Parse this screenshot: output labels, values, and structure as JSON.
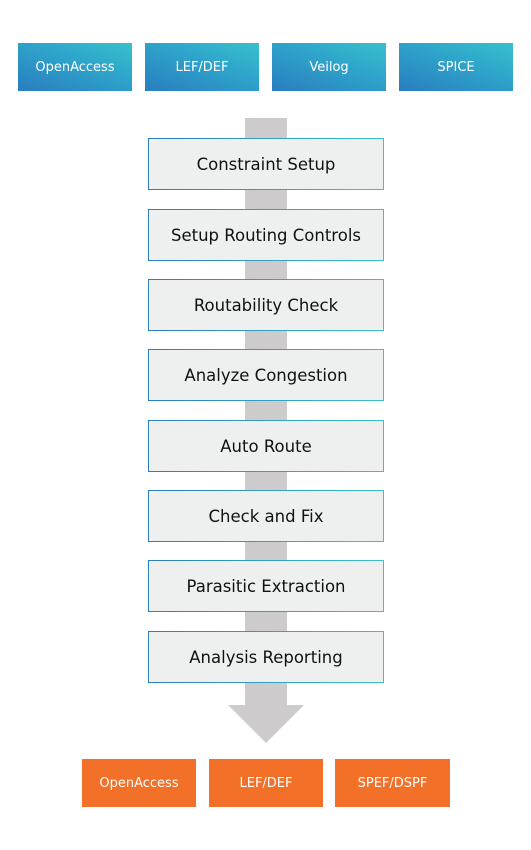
{
  "inputs": [
    "OpenAccess",
    "LEF/DEF",
    "Veilog",
    "SPICE"
  ],
  "steps": [
    "Constraint Setup",
    "Setup Routing Controls",
    "Routability Check",
    "Analyze Congestion",
    "Auto Route",
    "Check and Fix",
    "Parasitic Extraction",
    "Analysis Reporting"
  ],
  "outputs": [
    "OpenAccess",
    "LEF/DEF",
    "SPEF/DSPF"
  ],
  "colors": {
    "input_blue": "#2a7dbf",
    "input_teal": "#38c1cc",
    "output_orange": "#f37029",
    "step_bg": "#eef0ef",
    "arrow_gray": "#cdcbcc"
  }
}
